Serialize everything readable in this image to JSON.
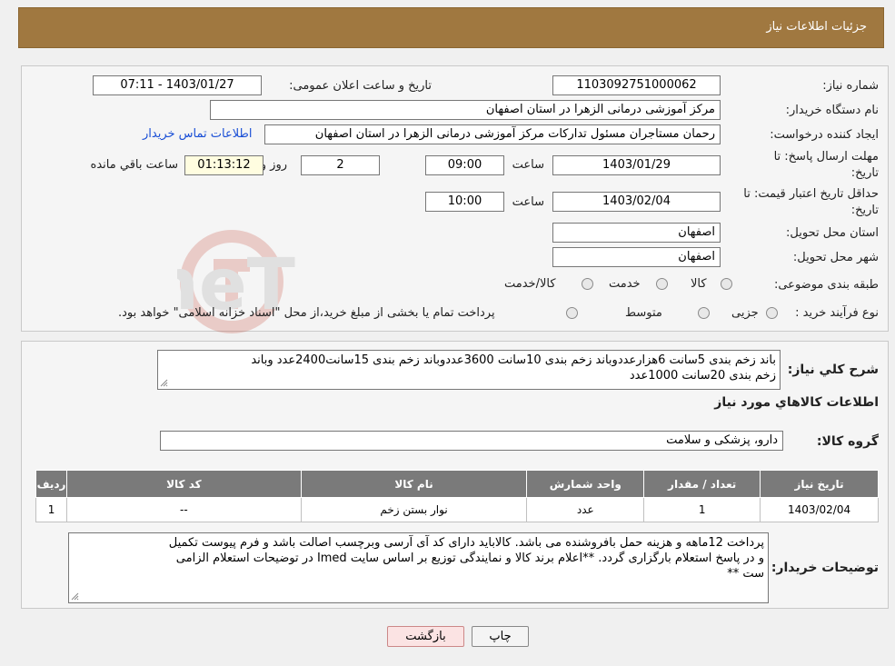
{
  "header": {
    "title": "جزئیات اطلاعات نیاز"
  },
  "form": {
    "need_number": {
      "label": "شماره نیاز:",
      "value": "1103092751000062"
    },
    "announce_datetime": {
      "label": "تاریخ و ساعت اعلان عمومی:",
      "value": "1403/01/27 - 07:11"
    },
    "buyer_org": {
      "label": "نام دستگاه خریدار:",
      "value": "مرکز آموزشی درمانی الزهرا در استان اصفهان"
    },
    "requester": {
      "label": "ایجاد کننده درخواست:",
      "value": "رحمان مستاجران مسئول تدارکات مرکز آموزشی درمانی الزهرا در استان اصفهان",
      "contact_link": "اطلاعات تماس خریدار"
    },
    "deadline": {
      "label_line1": "مهلت ارسال پاسخ: تا",
      "label_line2": "تاریخ:",
      "date": "1403/01/29",
      "time_label": "ساعت",
      "time": "09:00",
      "days": "2",
      "days_label": "روز و",
      "remaining": "01:13:12",
      "remaining_label": "ساعت باقي مانده"
    },
    "price_validity": {
      "label_line1": "حداقل تاریخ اعتبار قیمت: تا",
      "label_line2": "تاریخ:",
      "date": "1403/02/04",
      "time_label": "ساعت",
      "time": "10:00"
    },
    "delivery_province": {
      "label": "استان محل تحویل:",
      "value": "اصفهان"
    },
    "delivery_city": {
      "label": "شهر محل تحویل:",
      "value": "اصفهان"
    },
    "category": {
      "label": "طبقه بندی موضوعی:",
      "options": [
        "کالا",
        "خدمت",
        "کالا/خدمت"
      ]
    },
    "purchase_type": {
      "label": "نوع فرآیند خرید :",
      "options": [
        "جزیی",
        "متوسط"
      ],
      "note": "پرداخت تمام یا بخشی از مبلغ خرید،از محل \"اسناد خزانه اسلامی\" خواهد بود."
    }
  },
  "general_desc": {
    "label": "شرح کلي نياز:",
    "line1": "باند زخم بندی 5سانت 6هزارعددوباند زخم بندی 10سانت 3600عددوباند زخم بندی 15سانت2400عدد وباند",
    "line2": "زخم بندی 20سانت 1000عدد"
  },
  "items_section": {
    "title": "اطلاعات کالاهاي مورد نياز",
    "group_label": "گروه کالا:",
    "group_value": "دارو، پزشکی و سلامت",
    "columns": [
      "ردیف",
      "کد کالا",
      "نام کالا",
      "واحد شمارش",
      "تعداد / مقدار",
      "تاریخ نیاز"
    ],
    "rows": [
      [
        "1",
        "--",
        "نوار بستن زخم",
        "عدد",
        "1",
        "1403/02/04"
      ]
    ]
  },
  "buyer_notes": {
    "label": "توضیحات خریدار:",
    "line1": "پرداخت 12ماهه و هزینه حمل بافروشنده می باشد. کالاباید دارای کد آی آرسی وبرچسب اصالت باشد و فرم پیوست تکمیل",
    "line2": "و در پاسخ استعلام بارگزاری گردد. **اعلام برند کالا و نمایندگی توزیع بر اساس سایت Imed در توضیحات استعلام الزامی",
    "line3": "ست **"
  },
  "buttons": {
    "print": "چاپ",
    "back": "بازگشت"
  },
  "watermark": {
    "text": "AriaTender.neT"
  },
  "colors": {
    "header": "#a07840",
    "link": "#1a4fd6",
    "table_header": "#7a7a7a",
    "back_button": "#fbe3e3"
  }
}
